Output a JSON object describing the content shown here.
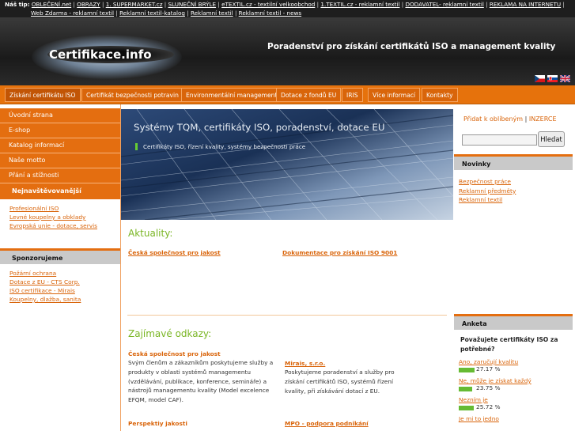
{
  "topbar": {
    "prefix": "Náš tip:",
    "links": [
      "OBLEČENÍ.net",
      "OBRAZY",
      "1. SUPERMARKET.cz",
      "SLUNEČNÍ BRÝLE",
      "eTEXTIL.cz - textilní velkoobchod",
      "1.TEXTIL.cz - reklamní textil",
      "DODAVATEL- reklamní textil",
      "REKLAMA NA INTERNETU",
      "Web Zdarma - reklamní textil",
      "Reklamní textil-katalog",
      "Reklamní textil",
      "Reklamní textil - news"
    ]
  },
  "header": {
    "site_title": "Certifikace.info",
    "tagline": "Poradenství pro získání certifikátů ISO a management kvality",
    "flags": [
      "czech-flag-icon",
      "slovak-flag-icon",
      "uk-flag-icon"
    ]
  },
  "nav": {
    "tabs": [
      "Získání certifikátu ISO",
      "Certifikát bezpečnosti potravin",
      "Environmentální management",
      "Dotace z fondů EU",
      "IRIS",
      "Více informací",
      "Kontakty"
    ]
  },
  "left": {
    "menu": [
      "Úvodní strana",
      "E-shop",
      "Katalog informací",
      "Naše motto",
      "Přání a stížnosti"
    ],
    "most_visited_title": "Nejnavštěvovanější",
    "most_visited": [
      "Profesionální ISO",
      "Levné koupelny a obklady",
      "Evropská unie - dotace, servis"
    ],
    "sponsor_title": "Sponzorujeme",
    "sponsors": [
      "Požární ochrana",
      "Dotace z EU - CTS Corp.",
      "ISO certifikace - Mirais",
      "Koupelny, dlažba, sanita"
    ]
  },
  "banner": {
    "title": "Systémy TQM, certifikáty ISO, poradenství, dotace EU",
    "subtitle": "Certifikáty ISO, řízení kvality, systémy bezpečnosti práce"
  },
  "main": {
    "news_title": "Aktuality:",
    "news_links": [
      "Česká společnost pro jakost",
      "Dokumentace pro získání ISO 9001"
    ],
    "links_title": "Zajímavé odkazy:",
    "odkazy": [
      {
        "title": "Česká společnost pro jakost",
        "text": "Svým členům a zákazníkům poskytujeme služby a produkty v oblasti systémů managementu (vzdělávání, publikace, konference, semináře) a nástrojů managementu kvality (Model excelence EFQM, model CAF)."
      },
      {
        "title": "Mirais, s.r.o.",
        "text": "Poskytujeme poradenství a služby pro získání certifikátů ISO, systémů řízení kvality, při získávání dotací z EU."
      },
      {
        "title": "Perspektiy jakosti",
        "text": ""
      },
      {
        "title": "MPO - podpora podnikání",
        "text": ""
      }
    ]
  },
  "right": {
    "favorite": "Přidat k oblíbeným",
    "sep": "|",
    "inzerce": "INZERCE",
    "search_button": "Hledat",
    "search_value": "",
    "novinky_title": "Novinky",
    "novinky": [
      "Bezpečnost práce",
      "Reklamní předměty",
      "Reklamní textil"
    ],
    "poll_title": "Anketa",
    "poll_question": "Považujete certifikáty ISO za potřebné?",
    "poll_options": [
      {
        "label": "Ano, zaručují kvalitu",
        "pct": "27.17 %",
        "value": 27.17
      },
      {
        "label": "Ne, může je získat každý",
        "pct": "23.75 %",
        "value": 23.75
      },
      {
        "label": "Nezním je",
        "pct": "25.72 %",
        "value": 25.72
      },
      {
        "label": "Je mi to jedno",
        "pct": "",
        "value": 0
      }
    ]
  },
  "colors": {
    "accent": "#e46e10",
    "green": "#7ab624",
    "link": "#d9640a"
  }
}
